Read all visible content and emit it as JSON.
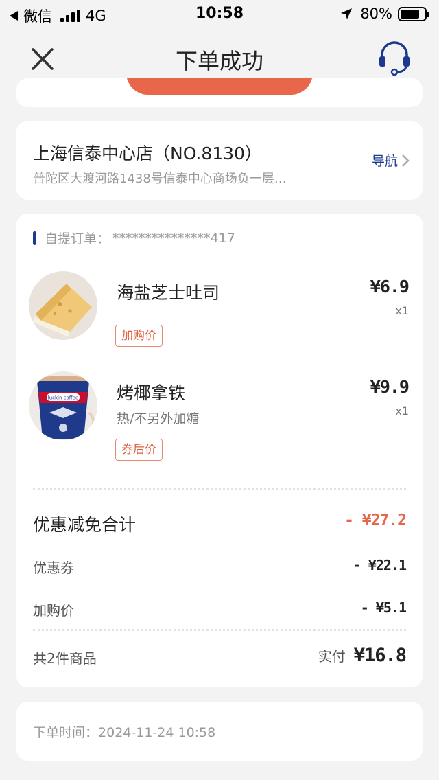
{
  "status_bar": {
    "carrier": "微信",
    "network": "4G",
    "time": "10:58",
    "battery": "80%",
    "battery_level": 0.8
  },
  "nav": {
    "title": "下单成功",
    "close_icon": "close-icon",
    "service_icon": "headset-icon"
  },
  "store": {
    "name": "上海信泰中心店（NO.8130）",
    "address": "普陀区大渡河路1438号信泰中心商场负一层…",
    "nav_label": "导航"
  },
  "order": {
    "label": "自提订单：",
    "number": "***************417",
    "items": [
      {
        "name": "海盐芝士吐司",
        "spec": "",
        "tag": "加购价",
        "price": "¥6.9",
        "qty": "x1"
      },
      {
        "name": "烤椰拿铁",
        "spec": "热/不另外加糖",
        "tag": "券后价",
        "price": "¥9.9",
        "qty": "x1",
        "cup_brand": "luckin coffee"
      }
    ],
    "discount_total_label": "优惠减免合计",
    "discount_total_value": "- ¥27.2",
    "coupon_label": "优惠券",
    "coupon_value": "- ¥22.1",
    "addon_label": "加购价",
    "addon_value": "- ¥5.1",
    "count_label": "共2件商品",
    "paid_label": "实付",
    "paid_value": "¥16.8"
  },
  "order_time": {
    "label": "下单时间：",
    "value": "2024-11-24 10:58"
  },
  "colors": {
    "accent_orange": "#e8674a",
    "brand_blue": "#1b3a8f",
    "background": "#f3f3f3"
  }
}
